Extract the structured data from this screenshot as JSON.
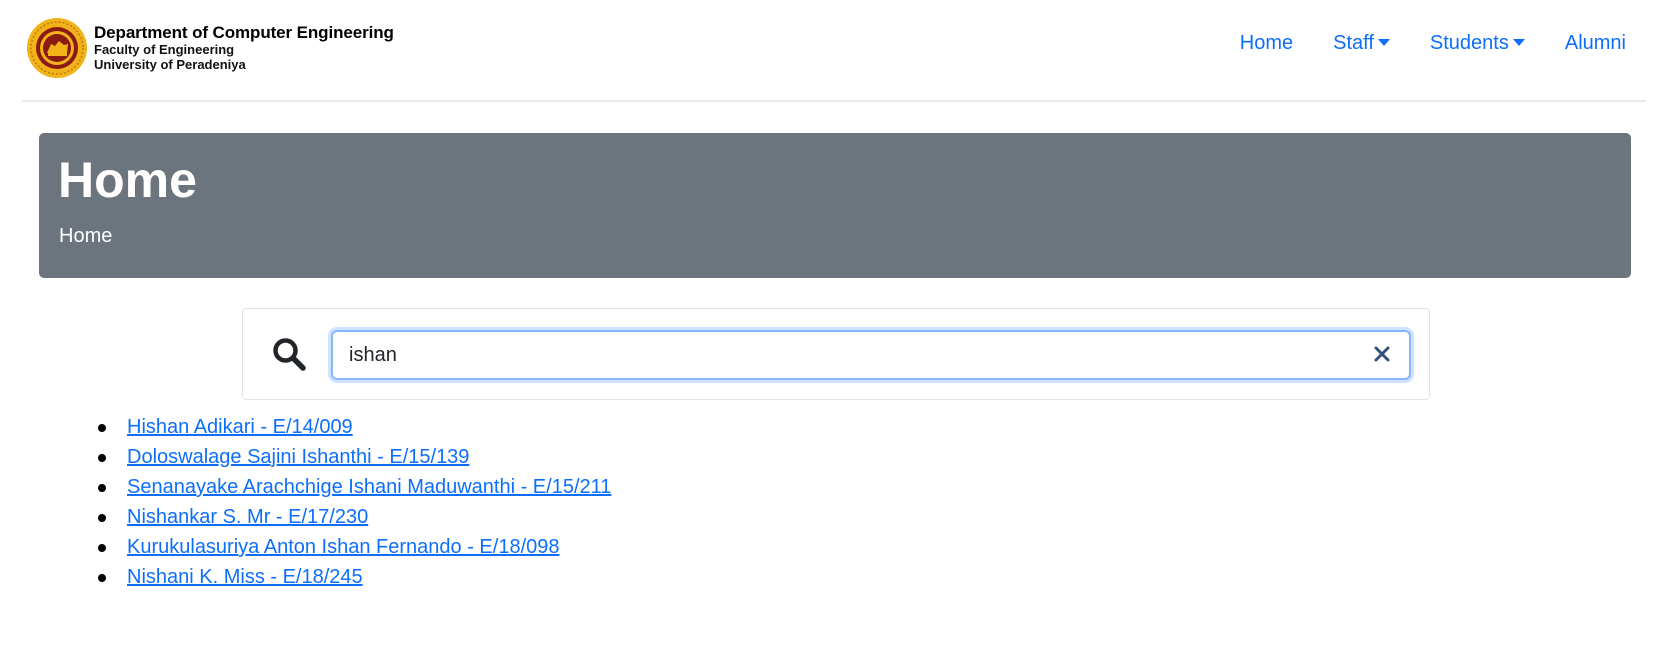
{
  "brand": {
    "title": "Department of  Computer Engineering",
    "faculty": "Faculty of Engineering",
    "university": "University of Peradeniya",
    "logo_icon": "university-crest-icon",
    "logo_colors": {
      "ring": "#f2b21a",
      "inner": "#8b1b12"
    }
  },
  "nav": {
    "items": [
      {
        "label": "Home",
        "dropdown": false
      },
      {
        "label": "Staff",
        "dropdown": true
      },
      {
        "label": "Students",
        "dropdown": true
      },
      {
        "label": "Alumni",
        "dropdown": false
      }
    ],
    "link_color": "#0d6efd"
  },
  "banner": {
    "title": "Home",
    "breadcrumb": "Home",
    "background": "#6c757d"
  },
  "search": {
    "icon": "search-icon",
    "value": "ishan",
    "clear_icon": "close-icon"
  },
  "results": [
    "Hishan Adikari - E/14/009",
    "Doloswalage Sajini Ishanthi - E/15/139",
    "Senanayake Arachchige Ishani Maduwanthi - E/15/211",
    "Nishankar S. Mr - E/17/230",
    "Kurukulasuriya Anton Ishan Fernando - E/18/098",
    "Nishani K. Miss - E/18/245"
  ]
}
